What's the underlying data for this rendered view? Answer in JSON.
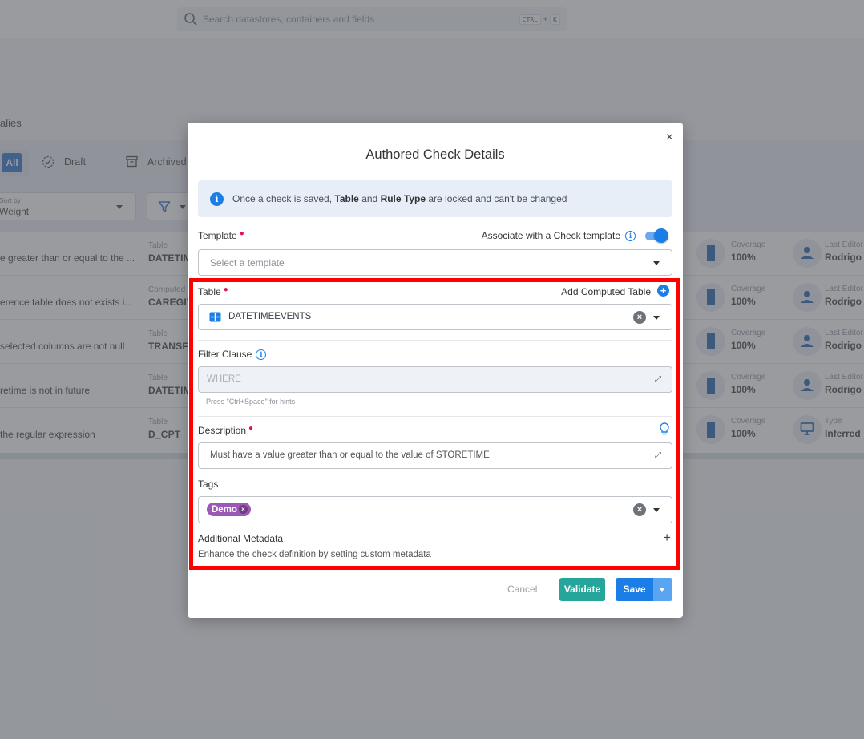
{
  "search": {
    "placeholder": "Search datastores, containers and fields",
    "shortcut_key1": "CTRL",
    "shortcut_plus": "+",
    "shortcut_key2": "K"
  },
  "background": {
    "page_title_partial": "alies",
    "tabs": [
      {
        "label": "All",
        "active": true
      },
      {
        "label": "Draft",
        "icon": "draft-icon"
      },
      {
        "label": "Archived",
        "icon": "archive-icon"
      }
    ],
    "sort": {
      "label": "Sort by",
      "value": "Weight"
    },
    "rows": [
      {
        "description": "e greater than or equal to the ...",
        "table_label": "Table",
        "table_value": "DATETIM",
        "coverage_label": "Coverage",
        "coverage_value": "100%",
        "meta_label": "Last Editor",
        "meta_value": "Rodrigo",
        "meta_icon": "user-icon"
      },
      {
        "description": "erence table does not exists i...",
        "table_label": "Computed",
        "table_value": "CAREGIV",
        "coverage_label": "Coverage",
        "coverage_value": "100%",
        "meta_label": "Last Editor",
        "meta_value": "Rodrigo",
        "meta_icon": "user-icon"
      },
      {
        "description": "selected columns are not null",
        "table_label": "Table",
        "table_value": "TRANSFE",
        "coverage_label": "Coverage",
        "coverage_value": "100%",
        "meta_label": "Last Editor",
        "meta_value": "Rodrigo",
        "meta_icon": "user-icon"
      },
      {
        "description": "retime is not in future",
        "table_label": "Table",
        "table_value": "DATETIM",
        "coverage_label": "Coverage",
        "coverage_value": "100%",
        "meta_label": "Last Editor",
        "meta_value": "Rodrigo",
        "meta_icon": "user-icon"
      },
      {
        "description": " the regular expression",
        "table_label": "Table",
        "table_value": "D_CPT",
        "coverage_label": "Coverage",
        "coverage_value": "100%",
        "meta_label": "Type",
        "meta_value": "Inferred",
        "meta_icon": "monitor-icon"
      }
    ]
  },
  "modal": {
    "title": "Authored Check Details",
    "close_symbol": "×",
    "info": {
      "prefix": "Once a check is saved, ",
      "bold1": "Table",
      "middle": " and ",
      "bold2": "Rule Type",
      "suffix": " are locked and can't be changed"
    },
    "template": {
      "label": "Template",
      "required": true,
      "placeholder": "Select a template",
      "associate_label": "Associate with a Check template",
      "associate_enabled": true
    },
    "table": {
      "label": "Table",
      "required": true,
      "add_computed_label": "Add Computed Table",
      "value": "DATETIMEEVENTS"
    },
    "filter": {
      "label": "Filter Clause",
      "placeholder": "WHERE",
      "hint": "Press \"Ctrl+Space\" for hints"
    },
    "description": {
      "label": "Description",
      "required": true,
      "value": "Must have a value greater than or equal to the value of STORETIME"
    },
    "tags": {
      "label": "Tags",
      "items": [
        {
          "label": "Demo",
          "color": "#9b59b6"
        }
      ]
    },
    "metadata": {
      "label": "Additional Metadata",
      "helper": "Enhance the check definition by setting custom metadata",
      "add_symbol": "+"
    },
    "buttons": {
      "cancel": "Cancel",
      "validate": "Validate",
      "save": "Save"
    }
  },
  "colors": {
    "primary": "#1a7ee6",
    "validate": "#26a69a",
    "required": "#e0115f",
    "highlight_frame": "#ff0000"
  }
}
